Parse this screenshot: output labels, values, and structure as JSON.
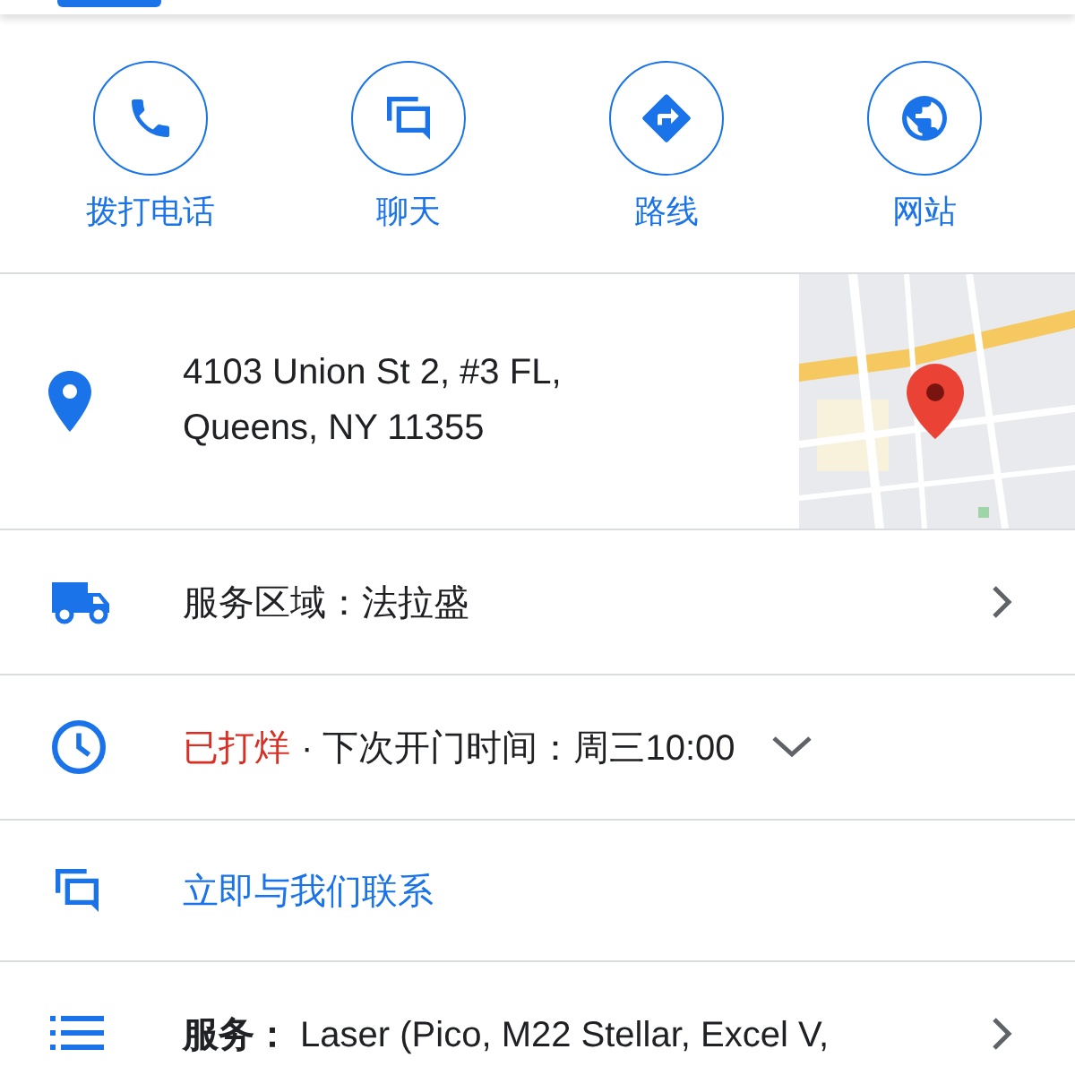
{
  "actions": [
    {
      "label": "拨打电话"
    },
    {
      "label": "聊天"
    },
    {
      "label": "路线"
    },
    {
      "label": "网站"
    }
  ],
  "address": {
    "lines": [
      "4103 Union St 2, #3 FL,",
      "Queens, NY 11355"
    ]
  },
  "rows": [
    {
      "kind": "nav",
      "text": "服务区域：法拉盛"
    },
    {
      "kind": "hours",
      "status": "已打烊",
      "text": "· 下次开门时间：周三10:00",
      "expanded": false
    },
    {
      "kind": "link",
      "text": "立即与我们联系"
    },
    {
      "kind": "nav",
      "text": "**服务：** Laser (Pico, M22 Stellar, Excel V,"
    }
  ]
}
